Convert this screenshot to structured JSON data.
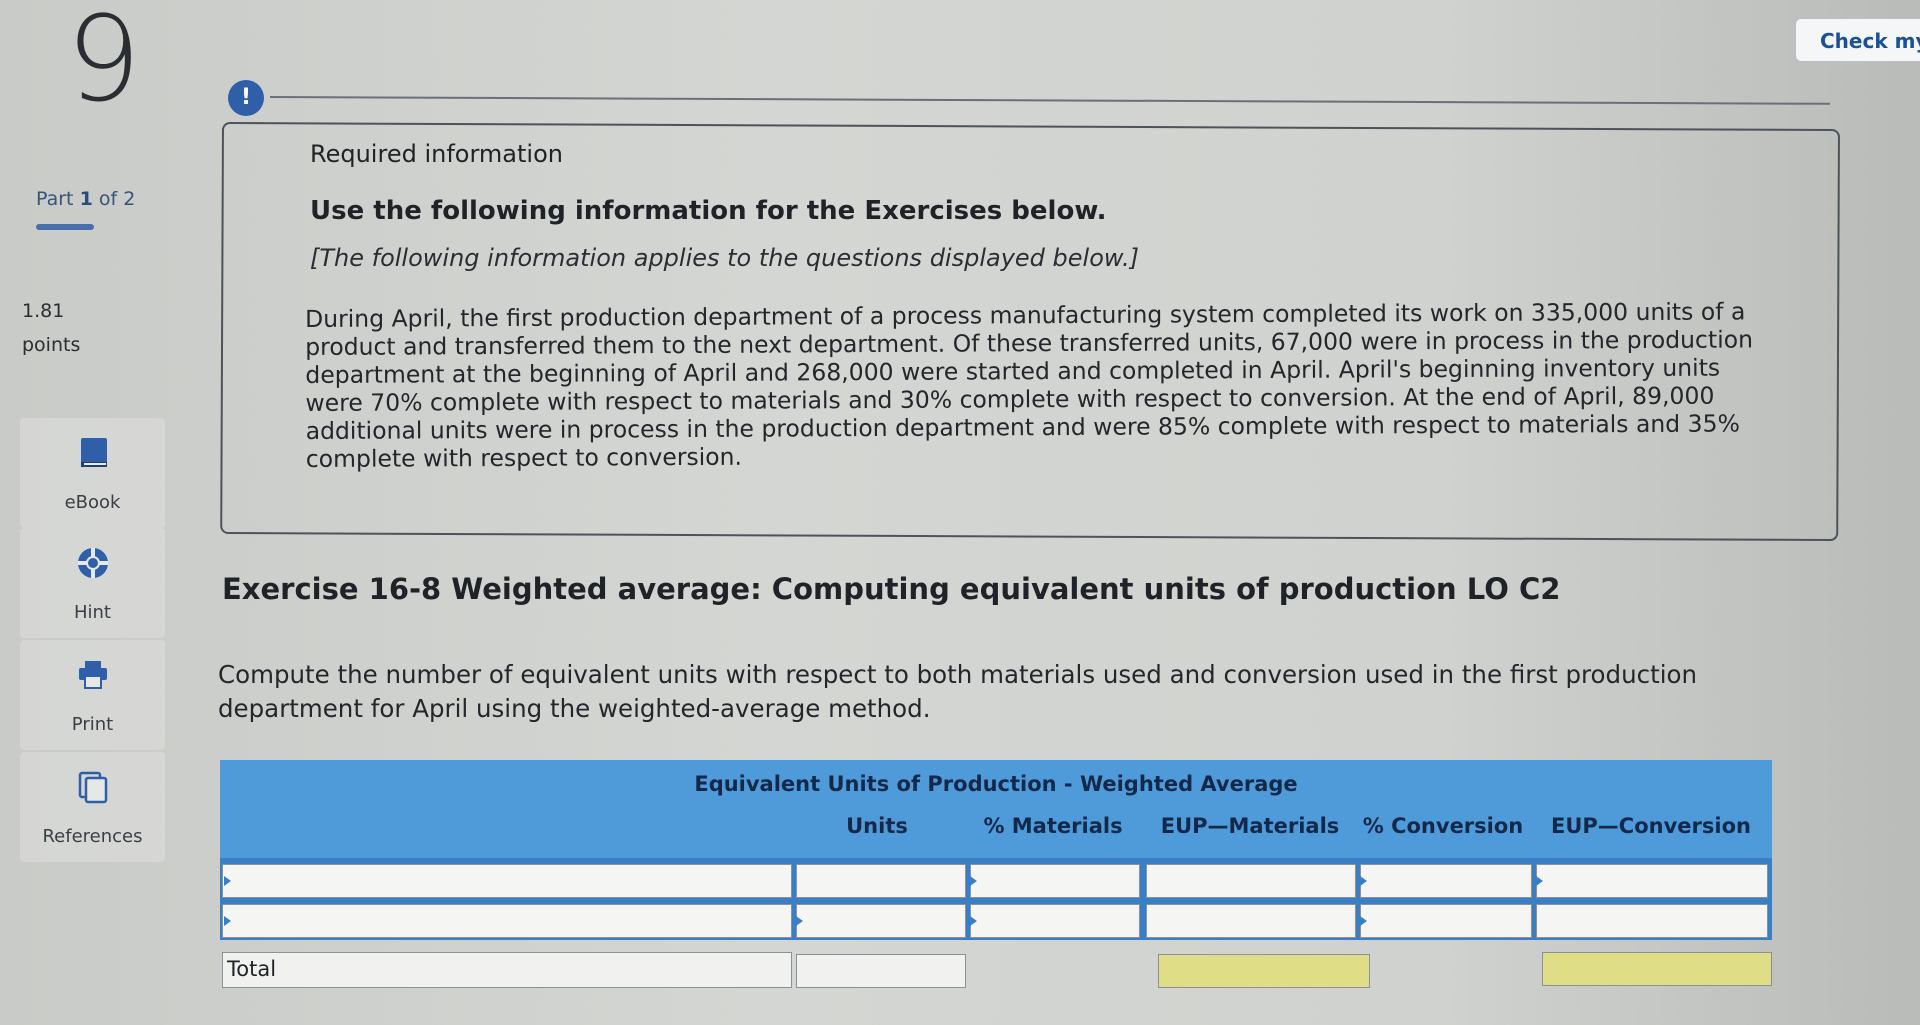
{
  "question": {
    "number": "9"
  },
  "header": {
    "check_label": "Check my"
  },
  "sidebar": {
    "part_label": "Part",
    "part_current": "1",
    "part_of": "of 2",
    "points_value": "1.81",
    "points_label": "points",
    "buttons": [
      {
        "label": "eBook",
        "icon": "book-icon"
      },
      {
        "label": "Hint",
        "icon": "lifebuoy-icon"
      },
      {
        "label": "Print",
        "icon": "printer-icon"
      },
      {
        "label": "References",
        "icon": "documents-icon"
      }
    ]
  },
  "info": {
    "alert_glyph": "!",
    "required_title": "Required information",
    "use_info": "Use the following information for the Exercises below.",
    "bracket_note": "[The following information applies to the questions displayed below.]",
    "body": "During April, the first production department of a process manufacturing system completed its work on 335,000 units of a product and transferred them to the next department. Of these transferred units, 67,000 were in process in the production department at the beginning of April and 268,000 were started and completed in April. April's beginning inventory units were 70% complete with respect to materials and 30% complete with respect to conversion. At the end of April, 89,000 additional units were in process in the production department and were 85% complete with respect to materials and 35% complete with respect to conversion."
  },
  "exercise": {
    "title": "Exercise 16-8 Weighted average: Computing equivalent units of production LO C2",
    "instructions": "Compute the number of equivalent units with respect to both materials used and conversion used in the first production department for April using the weighted-average method."
  },
  "table": {
    "title": "Equivalent Units of Production - Weighted Average",
    "columns": [
      "Units",
      "% Materials",
      "EUP—Materials",
      "% Conversion",
      "EUP—Conversion"
    ],
    "rows": [
      {
        "label": "",
        "units": "",
        "pct_materials": "",
        "eup_materials": "",
        "pct_conversion": "",
        "eup_conversion": ""
      },
      {
        "label": "",
        "units": "",
        "pct_materials": "",
        "eup_materials": "",
        "pct_conversion": "",
        "eup_conversion": ""
      }
    ],
    "total_label": "Total",
    "colors": {
      "header": "#4f9bd9",
      "highlight": "#dfdd86"
    }
  }
}
